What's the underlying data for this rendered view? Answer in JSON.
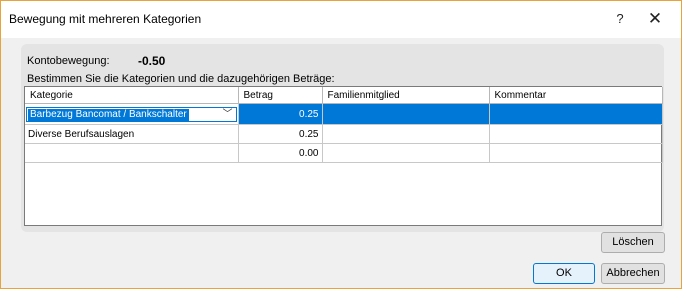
{
  "window": {
    "title": "Bewegung mit mehreren Kategorien",
    "help_label": "?",
    "close_label": "✕"
  },
  "account_movement": {
    "label": "Kontobewegung:",
    "value": "-0.50"
  },
  "instruction": "Bestimmen Sie die Kategorien und die dazugehörigen Beträge:",
  "grid": {
    "columns": [
      "Kategorie",
      "Betrag",
      "Familienmitglied",
      "Kommentar"
    ],
    "rows": [
      {
        "category": "Barbezug Bancomat / Bankschalter",
        "amount": "0.25",
        "family_member": "",
        "comment": ""
      },
      {
        "category": "Diverse Berufsauslagen",
        "amount": "0.25",
        "family_member": "",
        "comment": ""
      },
      {
        "category": "",
        "amount": "0.00",
        "family_member": "",
        "comment": ""
      }
    ],
    "selected_row": 0,
    "dropdown_arrow": "﹀"
  },
  "buttons": {
    "delete": "Löschen",
    "ok": "OK",
    "cancel": "Abbrechen"
  },
  "colors": {
    "selection": "#0078d7",
    "window_border": "#e8a33d"
  }
}
